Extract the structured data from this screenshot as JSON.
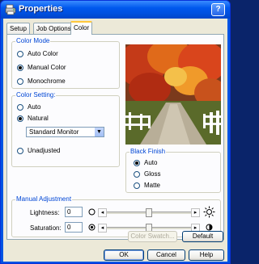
{
  "window": {
    "title": "Properties",
    "help_label": "?"
  },
  "tabs": [
    {
      "label": "Setup"
    },
    {
      "label": "Job Options"
    },
    {
      "label": "Color"
    }
  ],
  "color_mode": {
    "title": "Color Mode",
    "options": [
      "Auto Color",
      "Manual Color",
      "Monochrome"
    ],
    "selected": "Manual Color"
  },
  "color_setting": {
    "title": "Color Setting:",
    "options": [
      "Auto",
      "Natural",
      "Unadjusted"
    ],
    "selected": "Natural",
    "monitor_select": "Standard Monitor"
  },
  "black_finish": {
    "title": "Black Finish",
    "options": [
      "Auto",
      "Gloss",
      "Matte"
    ],
    "selected": "Auto"
  },
  "manual_adjustment": {
    "title": "Manual Adjustment",
    "lightness": {
      "label": "Lightness:",
      "value": "0",
      "slider_level": 0.5
    },
    "saturation": {
      "label": "Saturation:",
      "value": "0",
      "slider_level": 0.5
    }
  },
  "buttons": {
    "color_swatch": "Color Swatch...",
    "default": "Default",
    "ok": "OK",
    "cancel": "Cancel",
    "help": "Help"
  },
  "colors": {
    "title_bar": "#0054e3",
    "dialog_bg": "#ece9d8",
    "group_title": "#0046d5",
    "tab_highlight": "#ffc83c"
  }
}
